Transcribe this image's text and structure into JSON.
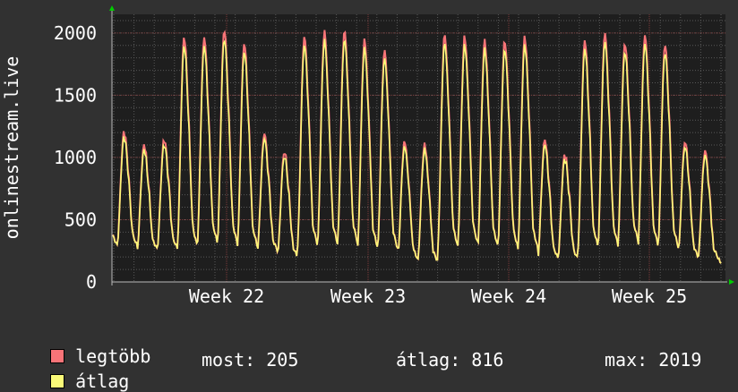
{
  "chart_data": {
    "type": "line",
    "ylabel": "onlinestream.live",
    "yticks": [
      0,
      500,
      1000,
      1500,
      2000
    ],
    "ylim": [
      0,
      2150
    ],
    "xtick_labels": [
      "Week 22",
      "Week 23",
      "Week 24",
      "Week 25"
    ],
    "grid": true,
    "series": [
      {
        "name": "legtöbb",
        "color": "#f87478"
      },
      {
        "name": "átlag",
        "color": "#fafa78"
      }
    ],
    "daily_peaks": [
      1220,
      1110,
      1160,
      1990,
      1980,
      2050,
      1940,
      1200,
      1060,
      1990,
      2020,
      2040,
      1960,
      1880,
      1140,
      1110,
      2010,
      1990,
      1950,
      1960,
      1990,
      1150,
      1040,
      1960,
      2010,
      1940,
      2000,
      1930,
      1140,
      1060
    ],
    "daily_mins": [
      290,
      260,
      270,
      280,
      310,
      300,
      280,
      250,
      200,
      290,
      300,
      310,
      270,
      260,
      180,
      160,
      280,
      300,
      280,
      270,
      260,
      190,
      180,
      280,
      290,
      330,
      290,
      280,
      200,
      190
    ],
    "stats": {
      "most_label": "most:",
      "most": "205",
      "atlag_label": "átlag:",
      "atlag": "816",
      "max_label": "max:",
      "max": "2019"
    }
  },
  "colors": {
    "background": "#313131",
    "plot": "#1e1e1e",
    "grid": "#585858",
    "axis": "#bbbbbb",
    "arrow": "#00cc00",
    "max": "#f87478",
    "avg": "#fafa78"
  }
}
